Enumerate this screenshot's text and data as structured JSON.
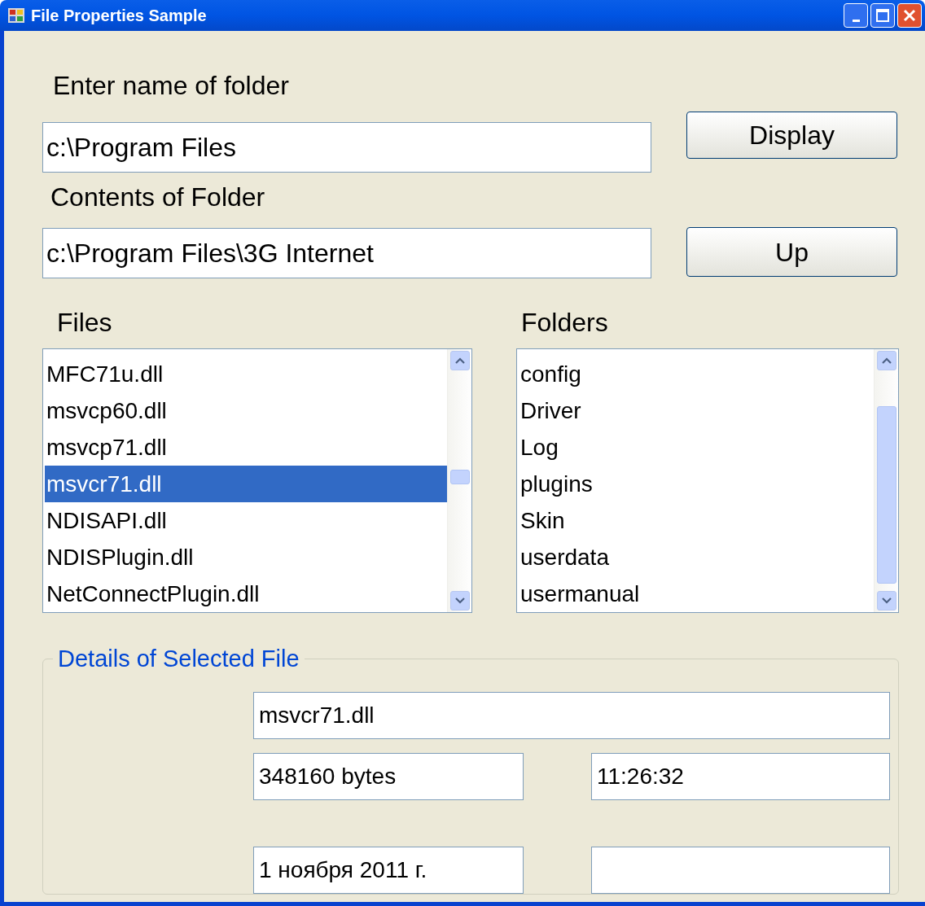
{
  "window": {
    "title": "File Properties Sample"
  },
  "folder_label": "Enter name of folder",
  "folder_field": {
    "value": "c:\\Program Files"
  },
  "display_button": "Display",
  "contents_label": "Contents of Folder",
  "contents_field": {
    "value": "c:\\Program Files\\3G Internet"
  },
  "up_button": "Up",
  "files": {
    "label": "Files",
    "items": [
      {
        "text": "MFC71u.dll",
        "selected": false
      },
      {
        "text": "msvcp60.dll",
        "selected": false
      },
      {
        "text": "msvcp71.dll",
        "selected": false
      },
      {
        "text": "msvcr71.dll",
        "selected": true
      },
      {
        "text": "NDISAPI.dll",
        "selected": false
      },
      {
        "text": "NDISPlugin.dll",
        "selected": false
      },
      {
        "text": "NetConnectPlugin.dll",
        "selected": false
      }
    ]
  },
  "folders": {
    "label": "Folders",
    "items": [
      {
        "text": "config",
        "selected": false
      },
      {
        "text": "Driver",
        "selected": false
      },
      {
        "text": "Log",
        "selected": false
      },
      {
        "text": "plugins",
        "selected": false
      },
      {
        "text": "Skin",
        "selected": false
      },
      {
        "text": "userdata",
        "selected": false
      },
      {
        "text": "usermanual",
        "selected": false
      }
    ]
  },
  "details": {
    "title": "Details of Selected File",
    "name": "msvcr71.dll",
    "size": "348160 bytes",
    "time": "11:26:32",
    "date": "1 ноября 2011 г."
  }
}
